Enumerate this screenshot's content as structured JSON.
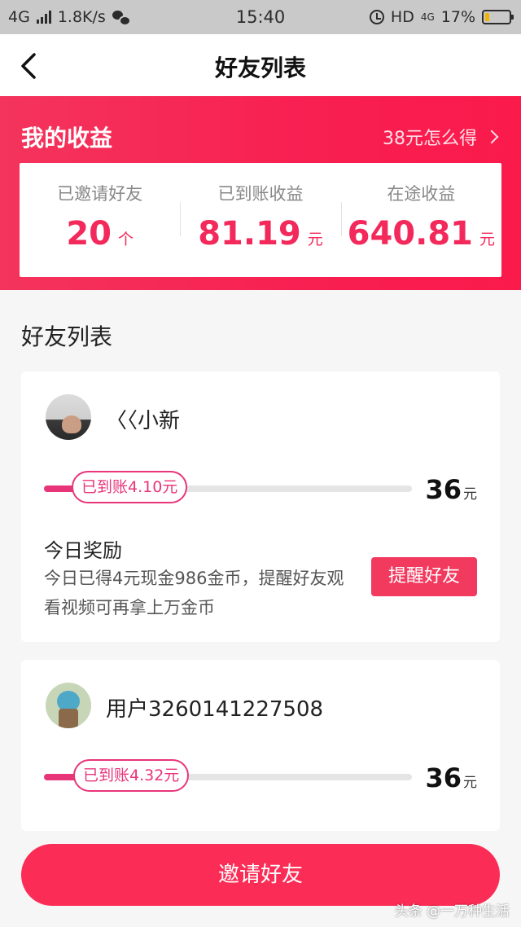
{
  "status_bar": {
    "network": "4G",
    "speed": "1.8K/s",
    "time": "15:40",
    "hd": "HD",
    "net2": "4G",
    "battery": "17%",
    "battery_level": 0.17
  },
  "header": {
    "title": "好友列表"
  },
  "earnings": {
    "title": "我的收益",
    "link": "38元怎么得",
    "stats": [
      {
        "label": "已邀请好友",
        "value": "20",
        "unit": "个"
      },
      {
        "label": "已到账收益",
        "value": "81.19",
        "unit": "元"
      },
      {
        "label": "在途收益",
        "value": "640.81",
        "unit": "元"
      }
    ]
  },
  "section_title": "好友列表",
  "friends": [
    {
      "name": "〈〈小新",
      "progress_label": "已到账4.10元",
      "progress_fraction": 0.114,
      "amount": "36",
      "amount_unit": "元",
      "reward_title": "今日奖励",
      "reward_desc": "今日已得4元现金986金币，提醒好友观看视频可再拿上万金币",
      "remind_label": "提醒好友"
    },
    {
      "name": "用户3260141227508",
      "progress_label": "已到账4.32元",
      "progress_fraction": 0.12,
      "amount": "36",
      "amount_unit": "元"
    }
  ],
  "invite_button": "邀请好友",
  "watermark": "头条 @一万种生活",
  "colors": {
    "accent": "#f81f51",
    "button": "#fb2c55",
    "progress": "#e8357a"
  }
}
